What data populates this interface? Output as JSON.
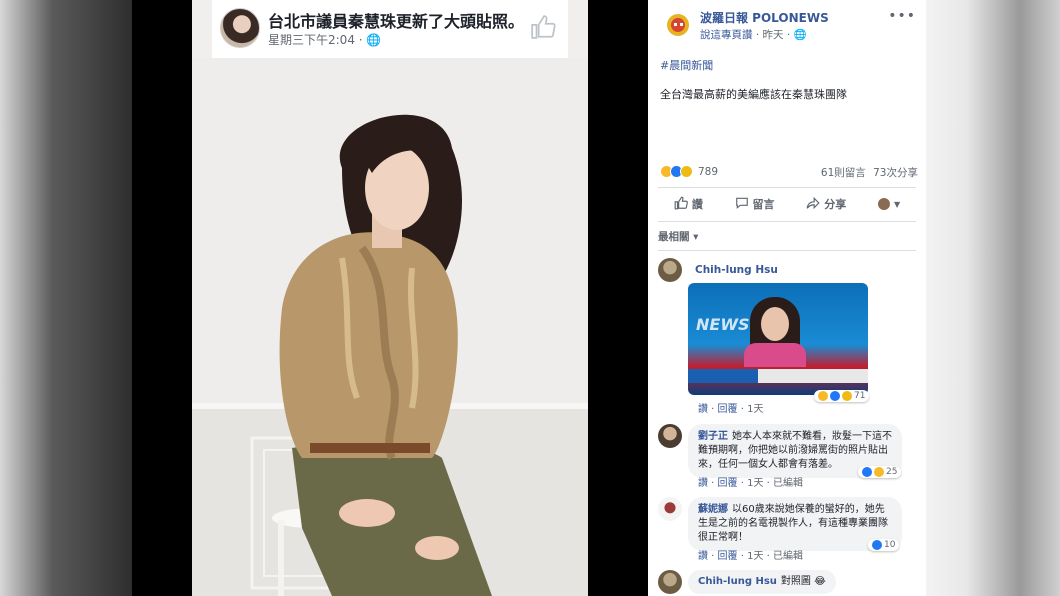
{
  "photo": {
    "title": "台北市議員秦慧珠更新了大頭貼照。",
    "time": "星期三下午2:04 · "
  },
  "post": {
    "page_name": "波羅日報 POLONEWS",
    "meta_link": "說這專頁讚",
    "meta_time": " · 昨天 · ",
    "hashtag": "#晨間新聞",
    "text": "全台灣最高薪的美編應該在秦慧珠團隊",
    "reaction_count": "789",
    "comments_count": "61則留言",
    "shares_count": "73次分享"
  },
  "actions": {
    "like": "讚",
    "comment": "留言",
    "share": "分享"
  },
  "sort": {
    "label": "最相關 ▾"
  },
  "comments": [
    {
      "author": "Chih-lung Hsu",
      "text": "",
      "like": "讚",
      "reply": "回覆",
      "time": "1天",
      "edited": "",
      "reacts": "71",
      "image_caption": "NEWS"
    },
    {
      "author": "劉子正",
      "text": "她本人本來就不難看，妝髮一下這不難預期啊，你把她以前潑婦罵街的照片貼出來，任何一個女人都會有落差。",
      "like": "讚",
      "reply": "回覆",
      "time": "1天",
      "edited": "已編輯",
      "reacts": "25"
    },
    {
      "author": "蘇妮娜",
      "text": "以60歲來說她保養的蠻好的，她先生是之前的名電視製作人，有這種專業團隊很正常啊！",
      "like": "讚",
      "reply": "回覆",
      "time": "1天",
      "edited": "已編輯",
      "reacts": "10"
    },
    {
      "author": "Chih-lung Hsu",
      "text": "對照圖 😂"
    }
  ],
  "icons": {
    "more": "more-icon",
    "like": "thumbs-up-icon",
    "comment": "comment-icon",
    "share": "share-icon",
    "globe": "globe-icon"
  },
  "colors": {
    "link": "#385898",
    "muted": "#606770",
    "like_blue": "#2078f4",
    "haha_yellow": "#f7b928"
  }
}
